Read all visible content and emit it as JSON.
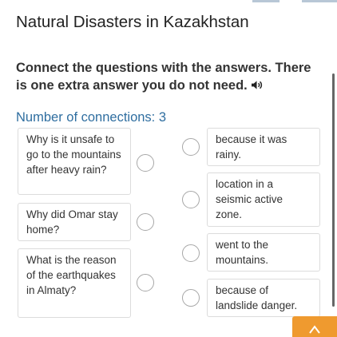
{
  "page": {
    "title": "Natural Disasters in Kazakhstan",
    "instruction": "Connect the questions with the answers. There is one extra answer you do not need.",
    "connections_text": "Number of connections: 3"
  },
  "questions": [
    {
      "text": "Why is it unsafe to go to the mountains after heavy rain?"
    },
    {
      "text": "Why did Omar stay home?"
    },
    {
      "text": "What is the reason of the earthquakes in Almaty?"
    }
  ],
  "answers": [
    {
      "text": "because it was rainy."
    },
    {
      "text": "location in a seismic active zone."
    },
    {
      "text": "went to the mountains."
    },
    {
      "text": "because of landslide danger."
    }
  ],
  "icons": {
    "speaker": "speaker-icon",
    "scroll_up": "chevron-up-icon"
  },
  "colors": {
    "accent": "#2f6ea0",
    "fab": "#ef9a2f"
  }
}
